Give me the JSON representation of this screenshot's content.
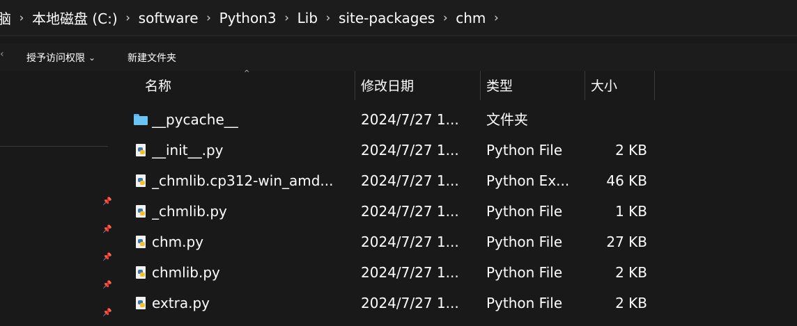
{
  "breadcrumb": {
    "items": [
      "脑",
      "本地磁盘 (C:)",
      "software",
      "Python3",
      "Lib",
      "site-packages",
      "chm"
    ],
    "separator": "›"
  },
  "toolbar": {
    "edge_glyph": "‹",
    "access_label": "授予访问权限",
    "access_chevron": "⌄",
    "new_folder_label": "新建文件夹"
  },
  "nav": {
    "pin_glyph": "📌"
  },
  "columns": {
    "name": "名称",
    "date": "修改日期",
    "type": "类型",
    "size": "大小",
    "sort_glyph": "^"
  },
  "files": [
    {
      "icon": "folder-icon",
      "name": "__pycache__",
      "date": "2024/7/27 1...",
      "type": "文件夹",
      "size": ""
    },
    {
      "icon": "python-file-icon",
      "name": "__init__.py",
      "date": "2024/7/27 1...",
      "type": "Python File",
      "size": "2 KB"
    },
    {
      "icon": "python-file-icon",
      "name": "_chmlib.cp312-win_amd...",
      "date": "2024/7/27 1...",
      "type": "Python Ex...",
      "size": "46 KB"
    },
    {
      "icon": "python-file-icon",
      "name": "_chmlib.py",
      "date": "2024/7/27 1...",
      "type": "Python File",
      "size": "1 KB"
    },
    {
      "icon": "python-file-icon",
      "name": "chm.py",
      "date": "2024/7/27 1...",
      "type": "Python File",
      "size": "27 KB"
    },
    {
      "icon": "python-file-icon",
      "name": "chmlib.py",
      "date": "2024/7/27 1...",
      "type": "Python File",
      "size": "2 KB"
    },
    {
      "icon": "python-file-icon",
      "name": "extra.py",
      "date": "2024/7/27 1...",
      "type": "Python File",
      "size": "2 KB"
    }
  ],
  "colors": {
    "background": "#191919",
    "text": "#ffffff",
    "folder": "#6cc4f5"
  }
}
